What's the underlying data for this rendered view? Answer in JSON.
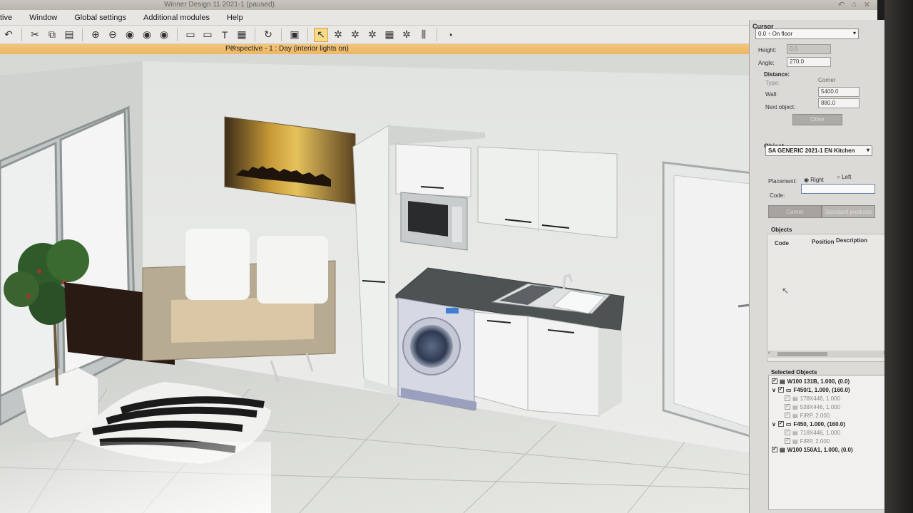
{
  "window": {
    "title": "Winner Design 11 2021-1 (paused)",
    "controls": [
      "↶",
      "⌂",
      "✕"
    ]
  },
  "menu": [
    "tive",
    "Window",
    "Global settings",
    "Additional modules",
    "Help"
  ],
  "toolbar_icons": [
    "undo-icon",
    "cut-icon",
    "copy-icon",
    "paste-icon",
    "zoom-in-icon",
    "zoom-out-icon",
    "zoom-window-icon",
    "zoom-all-icon",
    "zoom-prev-icon",
    "room-icon",
    "dimension-icon",
    "text-icon",
    "layers-icon",
    "refresh-icon",
    "calculator-icon",
    "select-cursor-icon",
    "wand-1-icon",
    "wand-2-icon",
    "wand-3-icon",
    "grid-icon",
    "wand-4-icon",
    "measure-icon",
    "camera-icon"
  ],
  "viewport": {
    "title": "Perspective - 1 : Day (interior lights on)"
  },
  "panel": {
    "cursor_header": "Cursor",
    "cursor_combo": "0.0 ↑ On floor",
    "height_label": "Height:",
    "height_value": "0.0",
    "angle_label": "Angle:",
    "angle_value": "270.0",
    "distance_header": "Distance:",
    "type_label": "Type:",
    "type_value": "Corner",
    "wall_label": "Wall:",
    "wall_value": "5400.0",
    "next_label": "Next object:",
    "next_value": "880.0",
    "other_button": "Other",
    "object_header": "Object",
    "object_combo": "SA GENERIC 2021-1 EN Kitchen",
    "placement_label": "Placement:",
    "placement_right": "Right",
    "placement_left": "Left",
    "code_label": "Code:",
    "code_value": "",
    "tab_corner": "Corner",
    "tab_standard": "Standard products",
    "objects_header": "Objects",
    "col_code": "Code",
    "col_position": "Position",
    "col_description": "Description",
    "selected_header": "Selected Objects",
    "selected": [
      {
        "text": "W100 131B, 1.000, (0.0)",
        "bold": true,
        "indent": 0,
        "expand": ""
      },
      {
        "text": "F450/1, 1.000, (160.0)",
        "bold": true,
        "indent": 0,
        "expand": "∨"
      },
      {
        "text": "178X446, 1.000",
        "bold": false,
        "indent": 1,
        "expand": ""
      },
      {
        "text": "538X446, 1.000",
        "bold": false,
        "indent": 1,
        "expand": ""
      },
      {
        "text": "F/RP, 2.000",
        "bold": false,
        "indent": 1,
        "expand": ""
      },
      {
        "text": "F450, 1.000, (160.0)",
        "bold": true,
        "indent": 0,
        "expand": "∨"
      },
      {
        "text": "718X446, 1.000",
        "bold": false,
        "indent": 1,
        "expand": ""
      },
      {
        "text": "F/RP, 2.000",
        "bold": false,
        "indent": 1,
        "expand": ""
      },
      {
        "text": "W100 150A1, 1.000, (0.0)",
        "bold": true,
        "indent": 0,
        "expand": ""
      }
    ]
  }
}
